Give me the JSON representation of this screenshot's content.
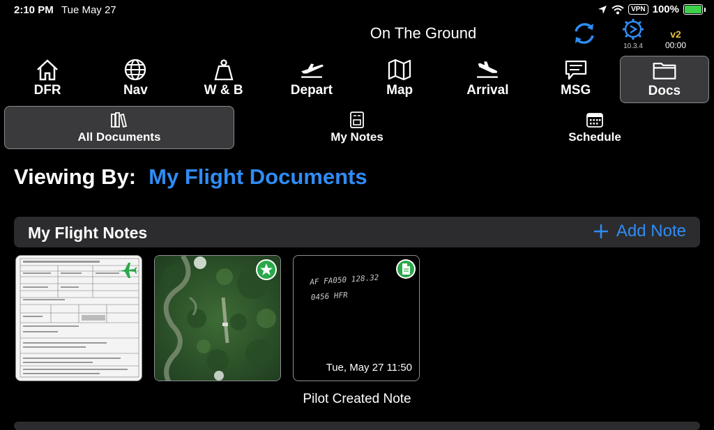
{
  "status_bar": {
    "time": "2:10 PM",
    "date": "Tue May 27",
    "vpn": "VPN",
    "battery": "100%"
  },
  "header": {
    "title": "On The Ground",
    "version": "10.3.4",
    "v2_label": "v2",
    "timer": "00:00"
  },
  "nav": [
    {
      "label": "DFR",
      "icon": "home-icon"
    },
    {
      "label": "Nav",
      "icon": "globe-icon"
    },
    {
      "label": "W & B",
      "icon": "weight-icon"
    },
    {
      "label": "Depart",
      "icon": "takeoff-icon"
    },
    {
      "label": "Map",
      "icon": "map-icon"
    },
    {
      "label": "Arrival",
      "icon": "landing-icon"
    },
    {
      "label": "MSG",
      "icon": "message-icon"
    },
    {
      "label": "Docs",
      "icon": "folder-icon",
      "active": true
    }
  ],
  "subnav": [
    {
      "label": "All Documents",
      "icon": "books-icon",
      "active": true
    },
    {
      "label": "My Notes",
      "icon": "notes-icon"
    },
    {
      "label": "Schedule",
      "icon": "calendar-icon"
    }
  ],
  "viewing": {
    "label": "Viewing By:",
    "value": "My Flight Documents"
  },
  "section": {
    "title": "My Flight Notes",
    "add_label": "Add Note"
  },
  "notes": [
    {
      "badge": "airplane-icon",
      "badge_color": "#2aa84a"
    },
    {
      "badge": "star-icon",
      "badge_color": "#2aa84a"
    },
    {
      "badge": "document-icon",
      "badge_color": "#2aa84a",
      "handwriting_line1": "AF FA050  128.32",
      "handwriting_line2": "0456  HFR",
      "date": "Tue, May 27  11:50",
      "caption": "Pilot Created Note"
    }
  ],
  "colors": {
    "accent": "#2f8cf5",
    "badge_green": "#2aa84a",
    "v2": "#e7c23a",
    "gear": "#2f8cf5"
  }
}
